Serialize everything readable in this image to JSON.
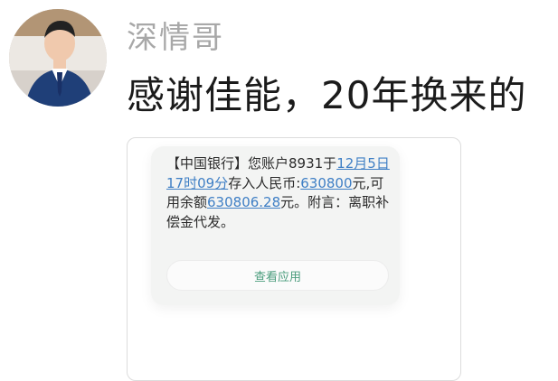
{
  "post": {
    "username": "深情哥",
    "text": "感谢佳能，20年换来的"
  },
  "sms": {
    "segments": [
      "【中国银行】您账户8931于",
      "12月5日17时09分",
      "存入人民币:",
      "630800",
      "元,可用余额",
      "630806.28",
      "元。附言：离职补偿金代发。"
    ],
    "view_app_label": "查看应用"
  },
  "colors": {
    "link": "#3f7fc5",
    "button_text": "#4a9c7c"
  }
}
